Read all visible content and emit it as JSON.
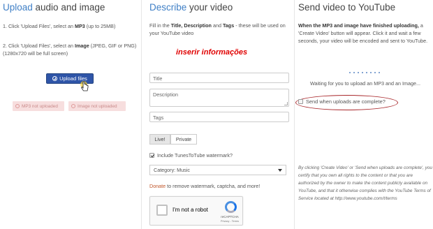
{
  "columns": {
    "upload": {
      "heading_accent": "Upload",
      "heading_rest": " audio and image",
      "step1_prefix": "1. Click 'Upload Files', select an ",
      "step1_bold": "MP3",
      "step1_suffix": " (up to 25MB)",
      "step2_prefix": "2. Click 'Upload Files', select an ",
      "step2_bold": "Image",
      "step2_suffix": " (JPEG, GIF or PNG) (1280x720 will be full screen)",
      "upload_button": "Upload files",
      "mp3_status": "MP3 not uploaded",
      "image_status": "Image not uploaded"
    },
    "describe": {
      "heading_accent": "Describe",
      "heading_rest": " your video",
      "intro_prefix": "Fill in the ",
      "intro_bold": "Title, Description",
      "intro_mid": " and ",
      "intro_bold2": "Tags",
      "intro_suffix": " - these will be used on your YouTube video",
      "overlay_text": "inserir informações",
      "title_placeholder": "Title",
      "description_placeholder": "Description",
      "tags_placeholder": "Tags",
      "privacy_live": "Live!",
      "privacy_private": "Private",
      "watermark_label": "Include TunesToTube watermark?",
      "category_value": "Category: Music",
      "donate_link": "Donate",
      "donate_rest": " to remove watermark, captcha, and more!",
      "recaptcha_label": "I'm not a robot",
      "recaptcha_brand": "reCAPTCHA",
      "recaptcha_terms": "Privacy - Terms"
    },
    "send": {
      "heading": "Send video to YouTube",
      "intro_bold": "When the MP3 and image have finished uploading,",
      "intro_rest": " a 'Create Video' button will appear. Click it and wait a few seconds, your video will be encoded and sent to YouTube.",
      "waiting_text": "Waiting for you to upload an MP3 and an Image...",
      "send_option": "Send when uploads are complete?",
      "disclaimer": "By clicking 'Create Video' or 'Send when uploads are complete', you certify that you own all rights to the content or that you are authorized by the owner to make the content publicly available on YouTube, and that it otherwise complies with the YouTube Terms of Service located at http://www.youtube.com/t/terms"
    }
  },
  "colors": {
    "accent": "#3f7fc6",
    "upload_button": "#2f55a8",
    "overlay_text": "#e00000",
    "status_badge_bg": "#f7dede",
    "highlight_ellipse": "#a8262a",
    "donate_link": "#c0562a"
  },
  "icons": {
    "upload_button_icon": "plus-circle-icon",
    "cursor": "hand-pointer-icon",
    "select_caret": "caret-down-icon",
    "recaptcha_logo": "recaptcha-logo-icon"
  }
}
